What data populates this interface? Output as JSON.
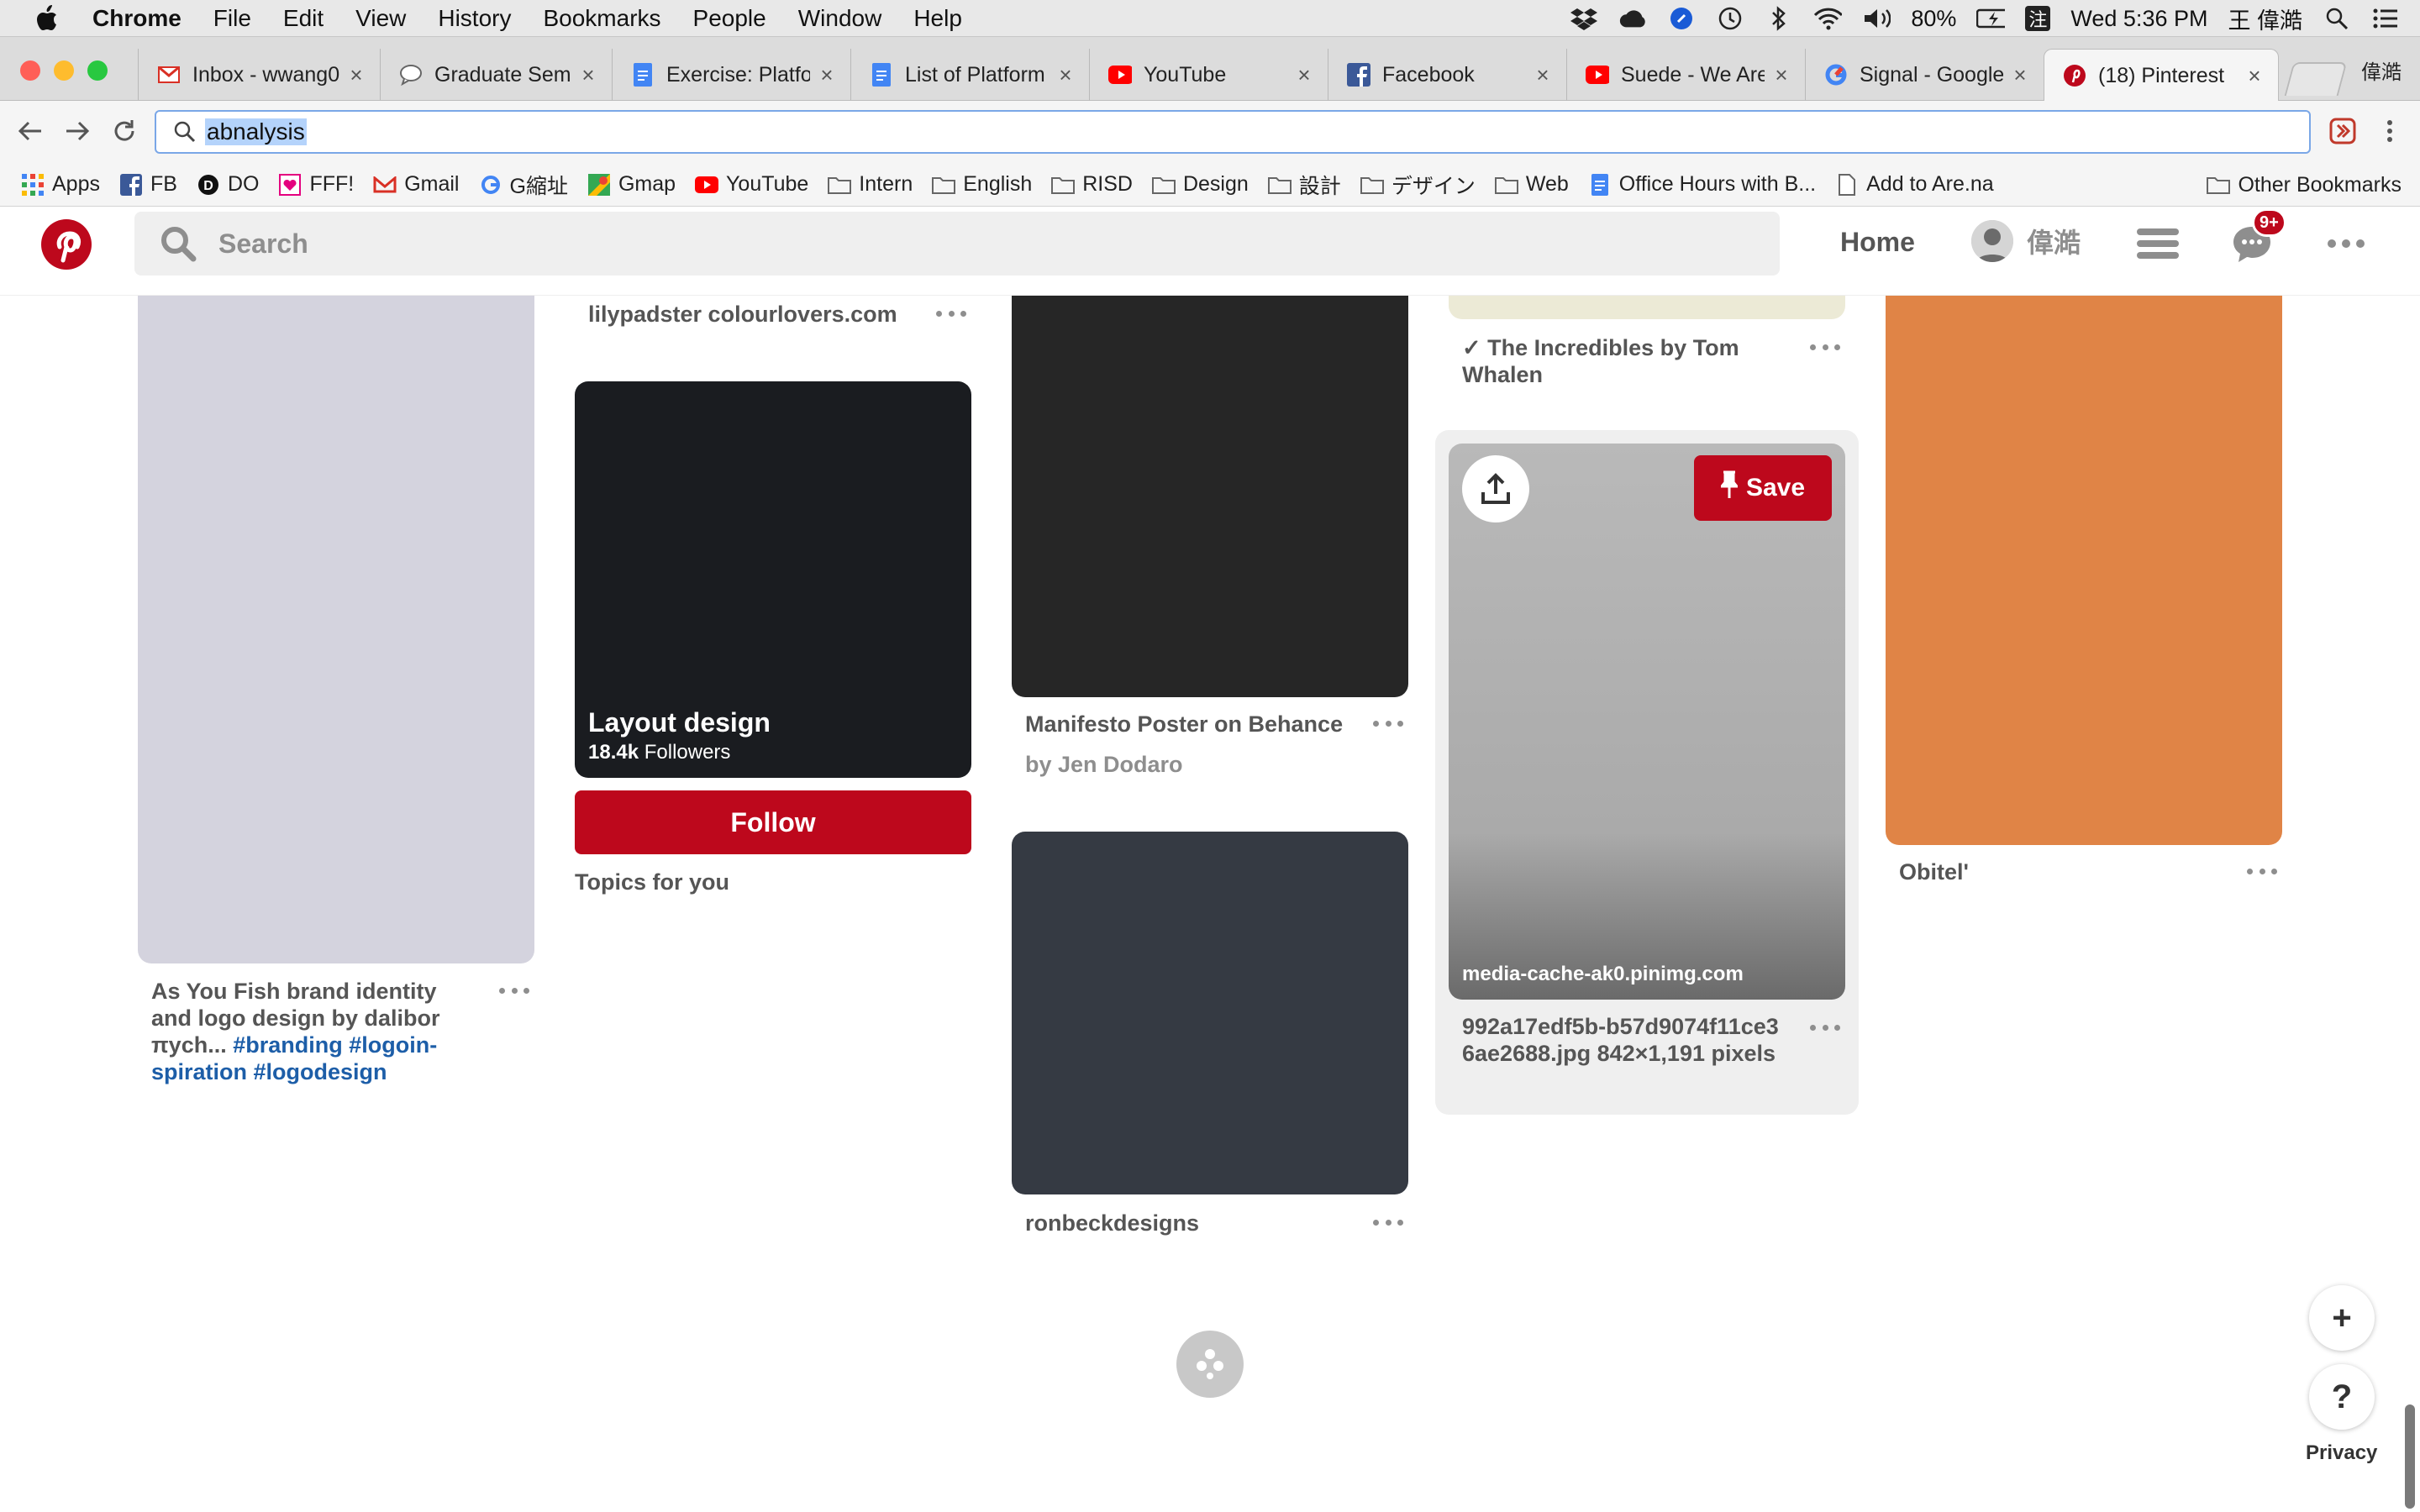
{
  "menubar": {
    "app": "Chrome",
    "items": [
      "File",
      "Edit",
      "View",
      "History",
      "Bookmarks",
      "People",
      "Window",
      "Help"
    ],
    "battery": "80%",
    "input_method": "注",
    "clock": "Wed 5:36 PM",
    "user": "王 偉澔"
  },
  "tabs": [
    {
      "title": "Inbox - wwang0",
      "icon": "gmail-icon"
    },
    {
      "title": "Graduate Semin",
      "icon": "chat-bubble-icon"
    },
    {
      "title": "Exercise: Platfo",
      "icon": "docs-icon"
    },
    {
      "title": "List of Platform",
      "icon": "docs-icon"
    },
    {
      "title": "YouTube",
      "icon": "youtube-icon"
    },
    {
      "title": "Facebook",
      "icon": "facebook-icon"
    },
    {
      "title": "Suede - We Are",
      "icon": "youtube-icon"
    },
    {
      "title": "Signal - Google",
      "icon": "google-icon"
    },
    {
      "title": "(18) Pinterest",
      "icon": "pinterest-icon",
      "active": true
    }
  ],
  "profile_label": "偉澔",
  "omnibox": {
    "value": "abnalysis"
  },
  "bookmarks": [
    {
      "label": "Apps",
      "icon": "apps-grid-icon"
    },
    {
      "label": "FB",
      "icon": "facebook-icon"
    },
    {
      "label": "DO",
      "icon": "do-icon"
    },
    {
      "label": "FFF!",
      "icon": "fff-icon"
    },
    {
      "label": "Gmail",
      "icon": "gmail-icon"
    },
    {
      "label": "G縮址",
      "icon": "google-icon"
    },
    {
      "label": "Gmap",
      "icon": "maps-icon"
    },
    {
      "label": "YouTube",
      "icon": "youtube-icon"
    },
    {
      "label": "Intern",
      "icon": "folder-icon"
    },
    {
      "label": "English",
      "icon": "folder-icon"
    },
    {
      "label": "RISD",
      "icon": "folder-icon"
    },
    {
      "label": "Design",
      "icon": "folder-icon"
    },
    {
      "label": "設計",
      "icon": "folder-icon"
    },
    {
      "label": "デザイン",
      "icon": "folder-icon"
    },
    {
      "label": "Web",
      "icon": "folder-icon"
    },
    {
      "label": "Office Hours with B...",
      "icon": "docs-icon"
    },
    {
      "label": "Add to Are.na",
      "icon": "page-icon"
    }
  ],
  "other_bookmarks": "Other Bookmarks",
  "pinterest": {
    "search_placeholder": "Search",
    "home": "Home",
    "username": "偉澔",
    "badge": "9+",
    "brand_color": "#bd081c"
  },
  "pins": {
    "col1": {
      "title_plain": "As You Fish brand identity and logo design by dalibor πych...",
      "tags": "#branding #logoin-spiration #logodesign"
    },
    "col2_caption": "lilypadster colourlovers.com",
    "topic": {
      "name": "Layout design",
      "count": "18.4k",
      "count_label": "Followers",
      "follow": "Follow",
      "section": "Topics for you"
    },
    "col3a": {
      "title": "Manifesto Poster on Behance",
      "by": "by Jen Dodaro"
    },
    "col3b": {
      "title": "ronbeckdesigns"
    },
    "col4a": {
      "title": "✓ The Incredibles by Tom Whalen"
    },
    "col4b": {
      "source": "media-cache-ak0.pinimg.com",
      "save": "Save",
      "title": "992a17edf5b-b57d9074f11ce36ae2688.jpg 842×1,191 pixels"
    },
    "col5": {
      "title": "Obitel'"
    }
  },
  "fab": {
    "plus": "+",
    "help": "?",
    "privacy": "Privacy"
  }
}
